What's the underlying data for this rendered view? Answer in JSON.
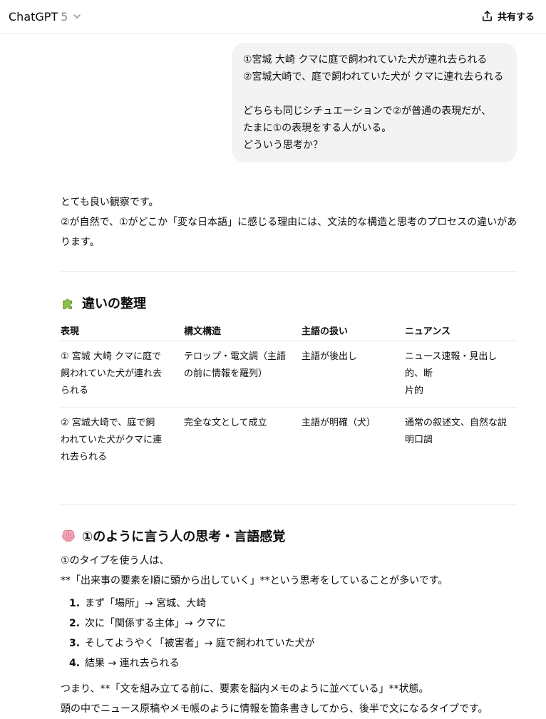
{
  "header": {
    "model_name": "ChatGPT",
    "model_version": "5",
    "share_label": "共有する"
  },
  "user_message": {
    "lines": [
      "①宮城 大崎 クマに庭で飼われていた犬が連れ去られる",
      "②宮城大崎で、庭で飼われていた犬が クマに連れ去られる",
      "",
      "どちらも同じシチュエーションで②が普通の表現だが、",
      "たまに①の表現をする人がいる。",
      "どういう思考か？"
    ]
  },
  "answer": {
    "intro": [
      "とても良い観察です。",
      "②が自然で、①がどこか「変な日本語」に感じる理由には、文法的な構造と思考のプロセスの違いがあ",
      "ります。"
    ],
    "section1": {
      "emoji": "puzzle-icon",
      "title": "違いの整理",
      "table": {
        "headers": [
          "表現",
          "構文構造",
          "主語の扱い",
          "ニュアンス"
        ],
        "rows": [
          {
            "expr": [
              "① 宮城 大崎 クマに庭で",
              "飼われていた犬が連れ去",
              "られる"
            ],
            "structure": [
              "テロップ・電文調（主語",
              "の前に情報を羅列）"
            ],
            "subject": [
              "主語が後出し"
            ],
            "nuance": [
              "ニュース速報・見出し的、断",
              "片的"
            ]
          },
          {
            "expr": [
              "② 宮城大崎で、庭で飼",
              "われていた犬がクマに連",
              "れ去られる"
            ],
            "structure": [
              "完全な文として成立"
            ],
            "subject": [
              "主語が明確（犬）"
            ],
            "nuance": [
              "通常の叙述文、自然な説",
              "明口調"
            ]
          }
        ]
      }
    },
    "section2": {
      "emoji": "brain-icon",
      "title": "①のように言う人の思考・言語感覚",
      "lead": [
        "①のタイプを使う人は、",
        "**「出来事の要素を順に頭から出していく」**という思考をしていることが多いです。"
      ],
      "steps": [
        {
          "num": "1.",
          "text": "まず「場所」→ 宮城、大崎"
        },
        {
          "num": "2.",
          "text": "次に「関係する主体」→ クマに"
        },
        {
          "num": "3.",
          "text": "そしてようやく「被害者」→ 庭で飼われていた犬が"
        },
        {
          "num": "4.",
          "text": "結果 → 連れ去られる"
        }
      ],
      "outro": [
        "つまり、**「文を組み立てる前に、要素を脳内メモのように並べている」**状態。",
        "頭の中でニュース原稿やメモ帳のように情報を箇条書きしてから、後半で文になるタイプです。"
      ]
    }
  }
}
